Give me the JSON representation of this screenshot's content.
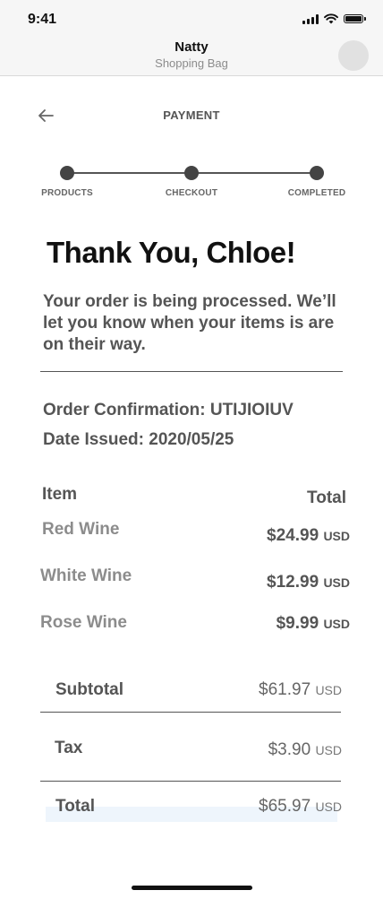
{
  "status_bar": {
    "time": "9:41"
  },
  "header": {
    "title": "Natty",
    "subtitle": "Shopping Bag"
  },
  "page": {
    "heading": "PAYMENT"
  },
  "steps": [
    {
      "label": "PRODUCTS"
    },
    {
      "label": "CHECKOUT"
    },
    {
      "label": "COMPLETED"
    }
  ],
  "thanks": "Thank You, Chloe!",
  "message": "Your order is being processed. We’ll let you know when your items is are on their way.",
  "order": {
    "confirmation_label": "Order Confirmation:",
    "confirmation_value": "UTIJIOIUV",
    "date_label": "Date Issued:",
    "date_value": "2020/05/25"
  },
  "items_table": {
    "col_item": "Item",
    "col_total": "Total",
    "rows": [
      {
        "name": "Red Wine",
        "price": "$24.99",
        "currency": "USD"
      },
      {
        "name": "White Wine",
        "price": "$12.99",
        "currency": "USD"
      },
      {
        "name": "Rose Wine",
        "price": "$9.99",
        "currency": "USD"
      }
    ]
  },
  "summary": {
    "subtotal_label": "Subtotal",
    "subtotal_value": "$61.97",
    "subtotal_currency": "USD",
    "tax_label": "Tax",
    "tax_value": "$3.90",
    "tax_currency": "USD",
    "total_label": "Total",
    "total_value": "$65.97",
    "total_currency": "USD"
  }
}
